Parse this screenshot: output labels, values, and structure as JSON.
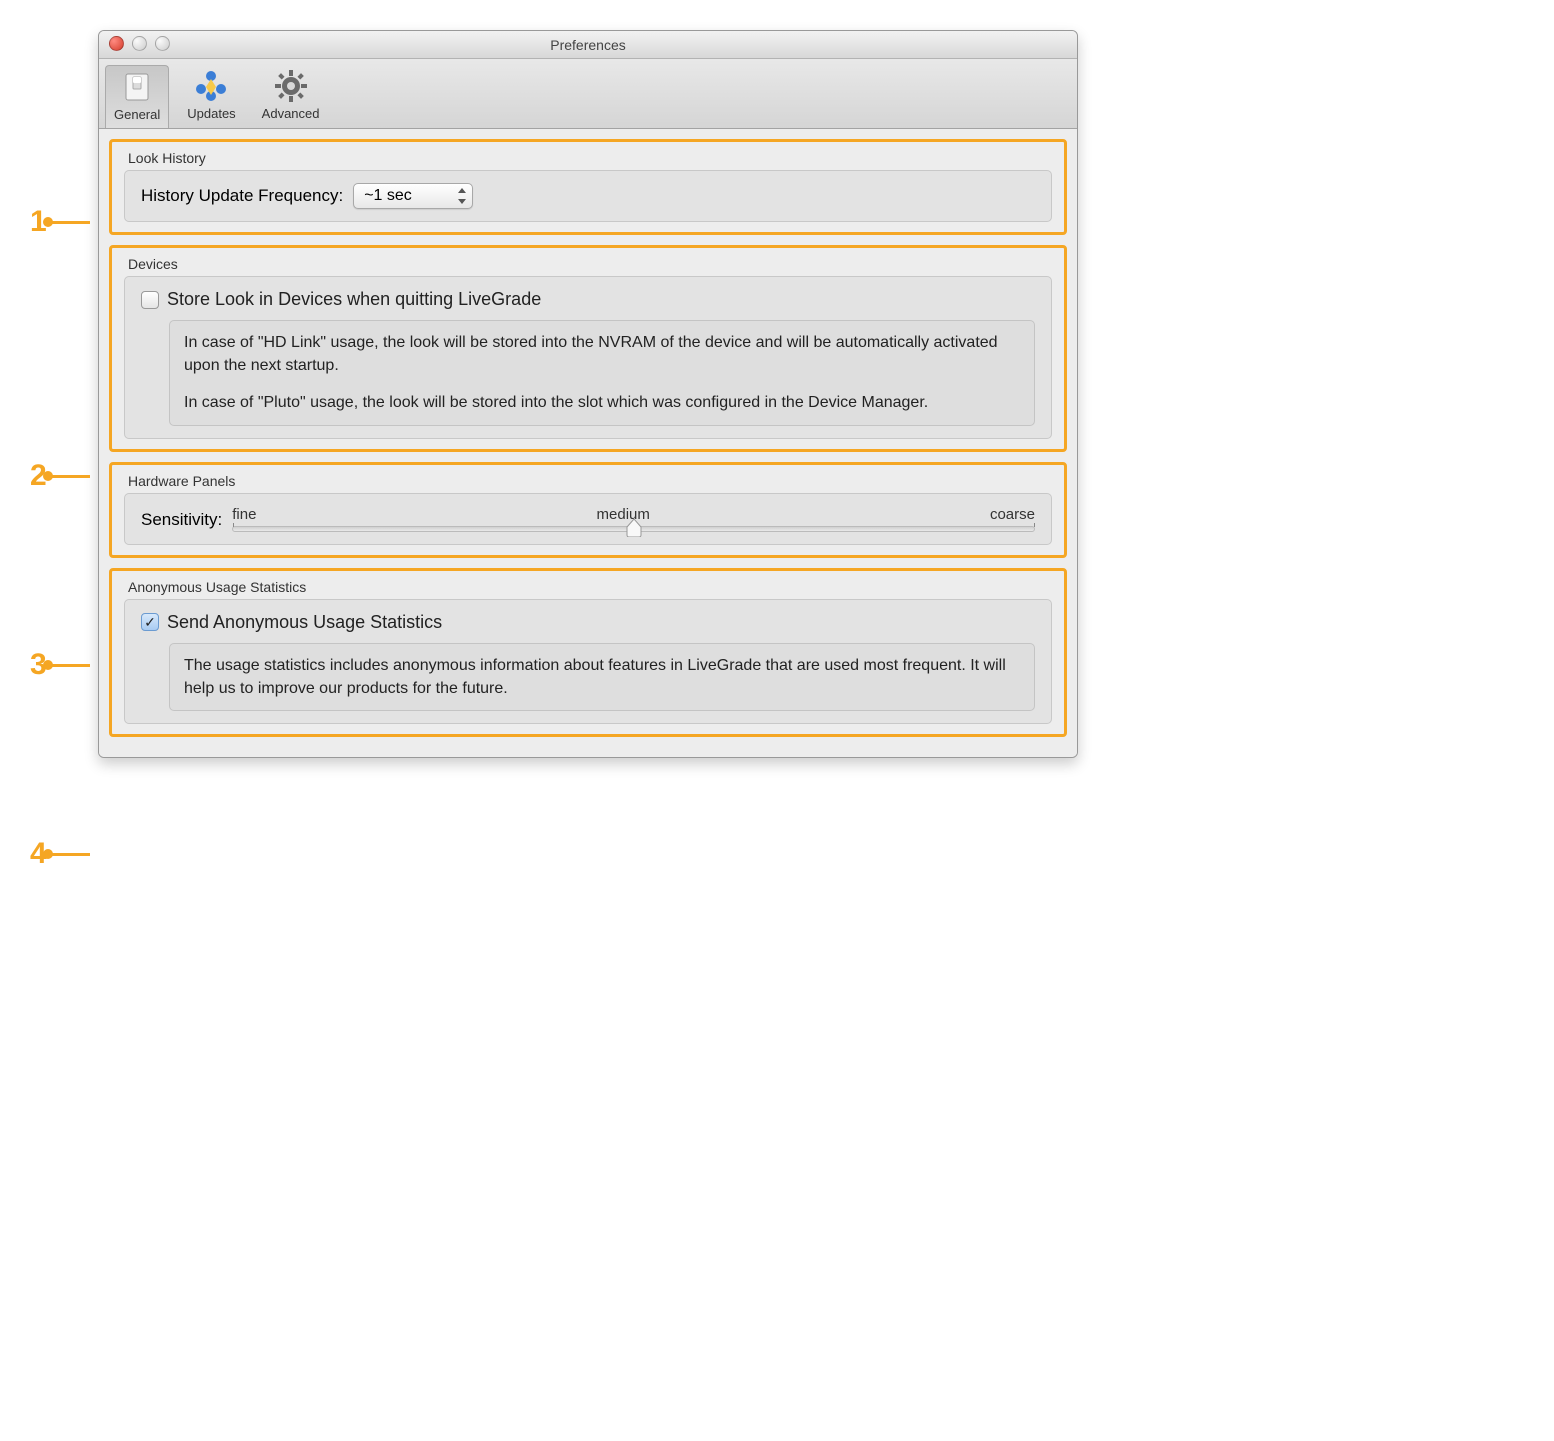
{
  "window": {
    "title": "Preferences"
  },
  "toolbar": {
    "tabs": [
      {
        "label": "General",
        "selected": true
      },
      {
        "label": "Updates",
        "selected": false
      },
      {
        "label": "Advanced",
        "selected": false
      }
    ]
  },
  "sections": {
    "lookHistory": {
      "title": "Look History",
      "freqLabel": "History Update Frequency:",
      "freqValue": "~1 sec"
    },
    "devices": {
      "title": "Devices",
      "checkboxLabel": "Store Look in Devices when quitting LiveGrade",
      "checked": false,
      "desc1": "In case of \"HD Link\" usage, the look will be stored into the NVRAM of the device and will be automatically activated upon the next startup.",
      "desc2": "In case of \"Pluto\" usage, the look will be stored into the slot which was configured in the Device Manager."
    },
    "hardware": {
      "title": "Hardware Panels",
      "label": "Sensitivity:",
      "ticks": [
        "fine",
        "medium",
        "coarse"
      ],
      "value": 50
    },
    "stats": {
      "title": "Anonymous Usage Statistics",
      "checkboxLabel": "Send Anonymous Usage Statistics",
      "checked": true,
      "desc": "The usage statistics includes anonymous information about features in LiveGrade that are used most frequent. It will help us to improve our products for the future."
    }
  },
  "annotations": [
    "1",
    "2",
    "3",
    "4"
  ]
}
